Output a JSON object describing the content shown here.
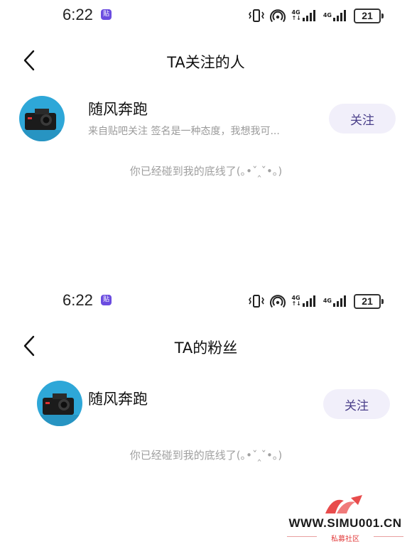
{
  "status_bar": {
    "time": "6:22",
    "app_badge": "贴",
    "network_a": [
      "4G",
      "↑↓"
    ],
    "network_b": [
      "4G",
      ""
    ],
    "battery": "21"
  },
  "screen_following": {
    "title": "TA关注的人",
    "user": {
      "name": "随风奔跑",
      "bio": "来自贴吧关注 签名是一种态度，我想我可...",
      "follow_label": "关注"
    },
    "end_text": "你已经碰到我的底线了(｡•ˇ‸ˇ•｡)"
  },
  "screen_fans": {
    "title": "TA的粉丝",
    "user": {
      "name": "随风奔跑",
      "follow_label": "关注"
    },
    "end_text": "你已经碰到我的底线了(｡•ˇ‸ˇ•｡)"
  },
  "watermark": {
    "text": "WWW.SIMU001.CN",
    "sub": "私募社区"
  },
  "colors": {
    "follow_button_bg": "#f1effa",
    "follow_button_text": "#4a3f8a",
    "muted_text": "#9b9b9b",
    "accent_badge": "#6b4ce0"
  }
}
